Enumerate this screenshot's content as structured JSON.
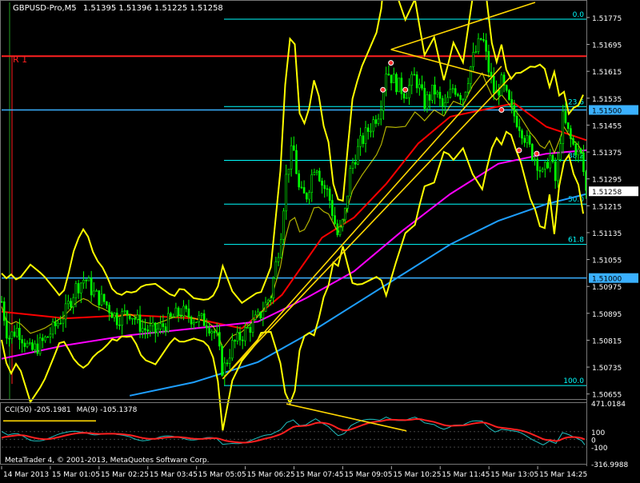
{
  "window": {
    "symbol_header": "GBPUSD-Pro,M5",
    "ohlc": "1.51395 1.51396 1.51225 1.51258"
  },
  "labels": {
    "r1": "R 1",
    "copyright": "MetaTrader 4, © 2001-2013, MetaQuotes Software Corp."
  },
  "colors": {
    "background": "#000000",
    "candles": "#00ff00",
    "bollinger": "#ffff00",
    "ma_red": "#ff0000",
    "ma_magenta": "#ff00ff",
    "ma_blue": "#1e9fff",
    "fibo": "#00ffff",
    "trendline": "#ffd700",
    "resistance": "#ff2020",
    "price_level": "#3ab0ff",
    "cci": "#ff2020",
    "cci_signal": "#20c0c0",
    "axis_text": "#ffffff"
  },
  "chart_data": {
    "type": "line",
    "price_axis": {
      "ticks": [
        "1.51775",
        "1.51695",
        "1.51615",
        "1.51535",
        "1.51455",
        "1.51375",
        "1.51295",
        "1.51215",
        "1.51135",
        "1.51055",
        "1.50975",
        "1.50895",
        "1.50815",
        "1.50735",
        "1.50655"
      ],
      "ylim": [
        1.5064,
        1.5182
      ]
    },
    "time_axis": [
      "14 Mar 2013",
      "15 Mar 01:05",
      "15 Mar 02:25",
      "15 Mar 03:45",
      "15 Mar 05:05",
      "15 Mar 06:25",
      "15 Mar 07:45",
      "15 Mar 09:05",
      "15 Mar 10:25",
      "15 Mar 11:45",
      "15 Mar 13:05",
      "15 Mar 14:25"
    ],
    "price_levels": [
      {
        "label": "1.51500",
        "value": 1.515
      },
      {
        "label": "1.51000",
        "value": 1.51
      },
      {
        "label": "1.51258",
        "value": 1.51258
      }
    ],
    "resistance": {
      "label": "R 1",
      "value": 1.5166
    },
    "fibonacci": [
      {
        "label": "0.0",
        "value": 1.5177
      },
      {
        "label": "23.6",
        "value": 1.5151
      },
      {
        "label": "38.2",
        "value": 1.5135
      },
      {
        "label": "50.0",
        "value": 1.5122
      },
      {
        "label": "61.8",
        "value": 1.511
      },
      {
        "label": "100.0",
        "value": 1.5068
      }
    ],
    "close_series": [
      [
        0,
        1.5093
      ],
      [
        4,
        1.5082
      ],
      [
        10,
        1.5085
      ],
      [
        18,
        1.5078
      ],
      [
        26,
        1.5081
      ],
      [
        34,
        1.5086
      ],
      [
        40,
        1.509
      ],
      [
        46,
        1.5097
      ],
      [
        52,
        1.51
      ],
      [
        58,
        1.5095
      ],
      [
        64,
        1.5093
      ],
      [
        72,
        1.5088
      ],
      [
        80,
        1.509
      ],
      [
        88,
        1.5085
      ],
      [
        96,
        1.5084
      ],
      [
        104,
        1.5087
      ],
      [
        112,
        1.509
      ],
      [
        120,
        1.5088
      ],
      [
        128,
        1.5087
      ],
      [
        134,
        1.5083
      ],
      [
        138,
        1.5072
      ],
      [
        144,
        1.508
      ],
      [
        152,
        1.5084
      ],
      [
        160,
        1.5088
      ],
      [
        168,
        1.5095
      ],
      [
        174,
        1.5112
      ],
      [
        178,
        1.5132
      ],
      [
        182,
        1.5139
      ],
      [
        186,
        1.5125
      ],
      [
        190,
        1.5124
      ],
      [
        196,
        1.5135
      ],
      [
        200,
        1.5128
      ],
      [
        204,
        1.5125
      ],
      [
        210,
        1.5112
      ],
      [
        214,
        1.5118
      ],
      [
        218,
        1.5133
      ],
      [
        224,
        1.514
      ],
      [
        230,
        1.5145
      ],
      [
        236,
        1.515
      ],
      [
        240,
        1.5162
      ],
      [
        246,
        1.5158
      ],
      [
        252,
        1.5155
      ],
      [
        258,
        1.516
      ],
      [
        264,
        1.5152
      ],
      [
        270,
        1.5156
      ],
      [
        276,
        1.515
      ],
      [
        282,
        1.5157
      ],
      [
        288,
        1.5154
      ],
      [
        294,
        1.5165
      ],
      [
        300,
        1.5172
      ],
      [
        304,
        1.5162
      ],
      [
        308,
        1.5154
      ],
      [
        312,
        1.5158
      ],
      [
        318,
        1.515
      ],
      [
        324,
        1.5145
      ],
      [
        330,
        1.5138
      ],
      [
        334,
        1.5135
      ],
      [
        338,
        1.513
      ],
      [
        342,
        1.5137
      ],
      [
        346,
        1.5128
      ],
      [
        350,
        1.5148
      ],
      [
        356,
        1.514
      ],
      [
        362,
        1.5136
      ],
      [
        365,
        1.5125
      ]
    ],
    "series": [
      {
        "name": "",
        "color": "#ff0000",
        "values": [
          [
            0,
            1.509
          ],
          [
            40,
            1.5088
          ],
          [
            80,
            1.5089
          ],
          [
            120,
            1.5088
          ],
          [
            150,
            1.5085
          ],
          [
            175,
            1.5095
          ],
          [
            200,
            1.5112
          ],
          [
            220,
            1.5118
          ],
          [
            240,
            1.5128
          ],
          [
            260,
            1.514
          ],
          [
            280,
            1.5148
          ],
          [
            300,
            1.515
          ],
          [
            320,
            1.5152
          ],
          [
            340,
            1.5145
          ],
          [
            365,
            1.5141
          ]
        ]
      },
      {
        "name": "",
        "color": "#ff00ff",
        "values": [
          [
            0,
            1.5076
          ],
          [
            40,
            1.508
          ],
          [
            80,
            1.5083
          ],
          [
            120,
            1.5085
          ],
          [
            160,
            1.5087
          ],
          [
            190,
            1.5094
          ],
          [
            220,
            1.5102
          ],
          [
            250,
            1.5114
          ],
          [
            280,
            1.5125
          ],
          [
            310,
            1.5134
          ],
          [
            340,
            1.5137
          ],
          [
            365,
            1.5138
          ]
        ]
      },
      {
        "name": "",
        "color": "#1e9fff",
        "values": [
          [
            80,
            1.5065
          ],
          [
            120,
            1.5069
          ],
          [
            160,
            1.5075
          ],
          [
            190,
            1.5083
          ],
          [
            220,
            1.5092
          ],
          [
            250,
            1.5101
          ],
          [
            280,
            1.511
          ],
          [
            310,
            1.5117
          ],
          [
            340,
            1.5122
          ],
          [
            365,
            1.5125
          ]
        ]
      }
    ],
    "cci": {
      "header": "CCI(50) -205.1981",
      "signal_header": "MA(9) -105.1378",
      "ticks": [
        "471.0184",
        "100",
        "0",
        "-100",
        "-316.9988"
      ],
      "ylim": [
        -316.9988,
        471.0184
      ]
    }
  }
}
